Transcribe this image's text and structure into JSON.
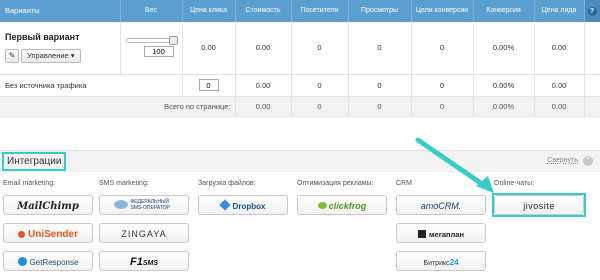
{
  "table": {
    "headers": [
      "Варианты",
      "Вес",
      "Цена клика",
      "Стоимость",
      "Посетители",
      "Просмотры",
      "Цели конверсии",
      "Конверсия",
      "Цена лида"
    ],
    "help_label": "?",
    "variant": {
      "name": "Первый вариант",
      "manage_label": "Управление",
      "weight": "100",
      "click_price": "0.00",
      "cost": "0.00",
      "visitors": "0",
      "views": "0",
      "goals": "0",
      "conversion": "0.00%",
      "lead_price": "0.00"
    },
    "no_source": {
      "label": "Без источника трафика",
      "click_price": "0",
      "cost": "0.00",
      "visitors": "0",
      "views": "0",
      "goals": "0",
      "conversion": "0.00%",
      "lead_price": "0.00"
    },
    "total": {
      "label": "Всего по странице:",
      "cost": "0.00",
      "visitors": "0",
      "views": "0",
      "goals": "0",
      "conversion": "0.00%",
      "lead_price": "0.00"
    }
  },
  "integrations": {
    "title": "Интеграции",
    "collapse_label": "Свернуть",
    "groups": {
      "email": {
        "label": "Email marketing:",
        "items": [
          "MailChimp",
          "UniSender",
          "GetResponse"
        ]
      },
      "sms": {
        "label": "SMS marketing:",
        "items": [
          "ФЕДЕРАЛЬНЫЙ SMS-ОПЕРАТОР",
          "ZINGAYA",
          "F1",
          "SMS"
        ]
      },
      "files": {
        "label": "Загрузка файлов:",
        "items": [
          "Dropbox"
        ]
      },
      "ads": {
        "label": "Оптимизация рекламы:",
        "items": [
          "clickfrog"
        ]
      },
      "crm": {
        "label": "CRM",
        "items": [
          "amoCRM.",
          "мегаплан",
          "Битрикс",
          "24"
        ]
      },
      "chats": {
        "label": "Online-чаты:",
        "items": [
          "jivosite"
        ]
      }
    }
  },
  "colors": {
    "header_blue": "#5b9fd1",
    "highlight_teal": "#37cdc6"
  },
  "icons": [
    "help-icon",
    "pencil-icon",
    "caret-down-icon",
    "collapse-icon",
    "arrow-annotation"
  ]
}
